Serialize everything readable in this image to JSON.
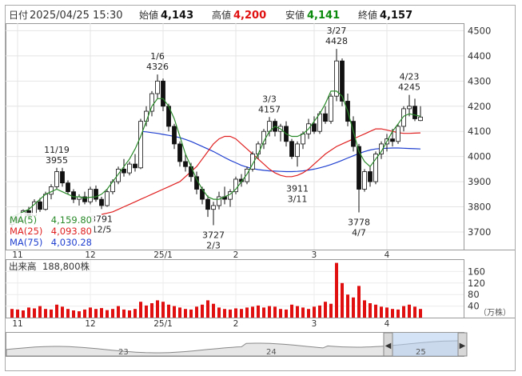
{
  "header": {
    "date_label": "日付",
    "datetime": "2025/04/25 15:30",
    "open_label": "始値",
    "open": "4,143",
    "high_label": "高値",
    "high": "4,200",
    "low_label": "安値",
    "low": "4,141",
    "close_label": "終値",
    "close": "4,157"
  },
  "colors": {
    "high": "#e01010",
    "low": "#0a8a0a",
    "ma5": "#2a8a2a",
    "ma25": "#e02020",
    "ma75": "#2040d0",
    "volume": "#e01010",
    "axis": "#555555"
  },
  "legend": [
    {
      "label": "MA(5)",
      "value": "4,159.80"
    },
    {
      "label": "MA(25)",
      "value": "4,093.80"
    },
    {
      "label": "MA(75)",
      "value": "4,030.28"
    }
  ],
  "volume_label": "出来高",
  "volume_value": "188,800株",
  "volume_unit": "（万株）",
  "annotations": [
    {
      "date": "11/19",
      "value": "3955"
    },
    {
      "date": "12/5",
      "value": "3791"
    },
    {
      "date": "1/6",
      "value": "4326"
    },
    {
      "date": "2/3",
      "value": "3727"
    },
    {
      "date": "3/3",
      "value": "4157"
    },
    {
      "date": "3/11",
      "value": "3911"
    },
    {
      "date": "3/27",
      "value": "4428"
    },
    {
      "date": "4/7",
      "value": "3778"
    },
    {
      "date": "4/23",
      "value": "4245"
    }
  ],
  "navigator": {
    "labels": [
      "23",
      "24",
      "25"
    ]
  },
  "chart_data": {
    "type": "candlestick",
    "price_axis": {
      "ylim": [
        3630,
        4530
      ],
      "ticks": [
        "4500",
        "4400",
        "4300",
        "4200",
        "4100",
        "4000",
        "3900",
        "3800",
        "3700"
      ]
    },
    "volume_axis": {
      "ylim": [
        0,
        200
      ],
      "ticks": [
        "160",
        "120",
        "80",
        "40"
      ]
    },
    "x_ticks": [
      {
        "label": "11",
        "x": 1
      },
      {
        "label": "12",
        "x": 14
      },
      {
        "label": "25/1",
        "x": 27
      },
      {
        "label": "2",
        "x": 40
      },
      {
        "label": "3",
        "x": 54
      },
      {
        "label": "4",
        "x": 67
      }
    ],
    "candles": [
      [
        3730,
        3760,
        3715,
        3755
      ],
      [
        3755,
        3775,
        3735,
        3745
      ],
      [
        3745,
        3790,
        3740,
        3785
      ],
      [
        3785,
        3800,
        3755,
        3765
      ],
      [
        3765,
        3830,
        3760,
        3820
      ],
      [
        3820,
        3835,
        3780,
        3790
      ],
      [
        3790,
        3860,
        3785,
        3850
      ],
      [
        3850,
        3890,
        3830,
        3880
      ],
      [
        3880,
        3955,
        3870,
        3940
      ],
      [
        3940,
        3955,
        3880,
        3895
      ],
      [
        3895,
        3905,
        3850,
        3860
      ],
      [
        3860,
        3870,
        3815,
        3830
      ],
      [
        3830,
        3850,
        3805,
        3840
      ],
      [
        3840,
        3860,
        3810,
        3820
      ],
      [
        3820,
        3880,
        3810,
        3870
      ],
      [
        3870,
        3885,
        3820,
        3830
      ],
      [
        3830,
        3840,
        3791,
        3805
      ],
      [
        3805,
        3870,
        3800,
        3860
      ],
      [
        3860,
        3910,
        3850,
        3900
      ],
      [
        3900,
        3960,
        3890,
        3950
      ],
      [
        3950,
        3990,
        3920,
        3935
      ],
      [
        3935,
        3980,
        3925,
        3970
      ],
      [
        3970,
        4010,
        3940,
        3955
      ],
      [
        3955,
        4150,
        3950,
        4140
      ],
      [
        4140,
        4200,
        4120,
        4180
      ],
      [
        4180,
        4260,
        4160,
        4250
      ],
      [
        4250,
        4326,
        4230,
        4300
      ],
      [
        4300,
        4310,
        4180,
        4200
      ],
      [
        4200,
        4210,
        4100,
        4120
      ],
      [
        4120,
        4130,
        4030,
        4050
      ],
      [
        4050,
        4060,
        3960,
        3980
      ],
      [
        3980,
        4010,
        3940,
        3960
      ],
      [
        3960,
        3975,
        3900,
        3920
      ],
      [
        3920,
        3940,
        3850,
        3870
      ],
      [
        3870,
        3880,
        3810,
        3830
      ],
      [
        3830,
        3845,
        3760,
        3790
      ],
      [
        3790,
        3820,
        3727,
        3805
      ],
      [
        3805,
        3860,
        3790,
        3840
      ],
      [
        3840,
        3880,
        3810,
        3830
      ],
      [
        3830,
        3870,
        3800,
        3860
      ],
      [
        3860,
        3920,
        3850,
        3910
      ],
      [
        3910,
        3930,
        3880,
        3900
      ],
      [
        3900,
        3960,
        3890,
        3950
      ],
      [
        3950,
        4020,
        3940,
        4010
      ],
      [
        4010,
        4060,
        3990,
        4050
      ],
      [
        4050,
        4110,
        4030,
        4100
      ],
      [
        4100,
        4157,
        4080,
        4140
      ],
      [
        4140,
        4150,
        4080,
        4100
      ],
      [
        4100,
        4130,
        4060,
        4120
      ],
      [
        4120,
        4140,
        4040,
        4060
      ],
      [
        4060,
        4070,
        3990,
        4000
      ],
      [
        4000,
        4060,
        3960,
        4050
      ],
      [
        4050,
        4100,
        4030,
        4090
      ],
      [
        4090,
        4150,
        4070,
        4130
      ],
      [
        4130,
        4160,
        4090,
        4100
      ],
      [
        4100,
        4180,
        4090,
        4170
      ],
      [
        4170,
        4200,
        4130,
        4140
      ],
      [
        4140,
        4250,
        4130,
        4240
      ],
      [
        4240,
        4428,
        4220,
        4380
      ],
      [
        4380,
        4390,
        4200,
        4220
      ],
      [
        4220,
        4250,
        4120,
        4140
      ],
      [
        4140,
        4160,
        4020,
        4040
      ],
      [
        4040,
        4050,
        3778,
        3870
      ],
      [
        3870,
        3950,
        3860,
        3940
      ],
      [
        3940,
        3960,
        3880,
        3900
      ],
      [
        3900,
        4020,
        3890,
        4010
      ],
      [
        4010,
        4060,
        3990,
        4050
      ],
      [
        4050,
        4090,
        4020,
        4070
      ],
      [
        4070,
        4110,
        4040,
        4060
      ],
      [
        4060,
        4130,
        4050,
        4120
      ],
      [
        4120,
        4200,
        4100,
        4190
      ],
      [
        4190,
        4245,
        4160,
        4200
      ],
      [
        4200,
        4230,
        4141,
        4150
      ],
      [
        4143,
        4200,
        4141,
        4157
      ]
    ],
    "ma5": [
      3760,
      3770,
      3780,
      3790,
      3810,
      3830,
      3850,
      3860,
      3870,
      3860,
      3850,
      3840,
      3840,
      3835,
      3838,
      3840,
      3850,
      3870,
      3900,
      3930,
      3960,
      3990,
      4030,
      4080,
      4140,
      4200,
      4230,
      4230,
      4200,
      4150,
      4080,
      4010,
      3960,
      3910,
      3870,
      3840,
      3830,
      3830,
      3840,
      3850,
      3870,
      3900,
      3930,
      3970,
      4010,
      4060,
      4100,
      4120,
      4110,
      4090,
      4080,
      4080,
      4090,
      4110,
      4140,
      4170,
      4210,
      4260,
      4260,
      4240,
      4180,
      4100,
      4020,
      3980,
      3960,
      3990,
      4020,
      4060,
      4100,
      4130,
      4160,
      4170,
      4165,
      4160
    ],
    "ma25": [
      3770,
      3775,
      3780,
      3790,
      3800,
      3810,
      3820,
      3830,
      3840,
      3850,
      3860,
      3870,
      3880,
      3890,
      3900,
      3920,
      3940,
      3960,
      3990,
      4020,
      4050,
      4070,
      4080,
      4080,
      4070,
      4050,
      4030,
      4010,
      3990,
      3970,
      3950,
      3935,
      3925,
      3920,
      3920,
      3925,
      3935,
      3950,
      3970,
      3990,
      4010,
      4025,
      4040,
      4050,
      4060,
      4070,
      4080,
      4090,
      4100,
      4110,
      4110,
      4105,
      4100,
      4095,
      4092,
      4092,
      4093,
      4094
    ],
    "ma75": [
      4100,
      4098,
      4095,
      4092,
      4088,
      4084,
      4080,
      4075,
      4068,
      4060,
      4050,
      4040,
      4030,
      4020,
      4008,
      3996,
      3985,
      3975,
      3965,
      3958,
      3952,
      3948,
      3945,
      3943,
      3942,
      3941,
      3940,
      3940,
      3941,
      3943,
      3946,
      3950,
      3955,
      3961,
      3968,
      3976,
      3985,
      3994,
      4003,
      4012,
      4020,
      4026,
      4030,
      4032,
      4033,
      4034,
      4034,
      4033,
      4032,
      4031,
      4030
    ],
    "volume": [
      30,
      28,
      25,
      35,
      32,
      40,
      30,
      28,
      45,
      38,
      30,
      25,
      22,
      28,
      35,
      30,
      33,
      26,
      30,
      40,
      28,
      25,
      30,
      55,
      42,
      50,
      60,
      55,
      45,
      40,
      35,
      30,
      28,
      38,
      45,
      60,
      48,
      35,
      30,
      28,
      32,
      30,
      35,
      38,
      42,
      35,
      40,
      38,
      30,
      28,
      45,
      40,
      35,
      30,
      38,
      42,
      55,
      48,
      190,
      120,
      80,
      70,
      110,
      60,
      50,
      45,
      38,
      35,
      30,
      28,
      40,
      45,
      38,
      30
    ]
  }
}
